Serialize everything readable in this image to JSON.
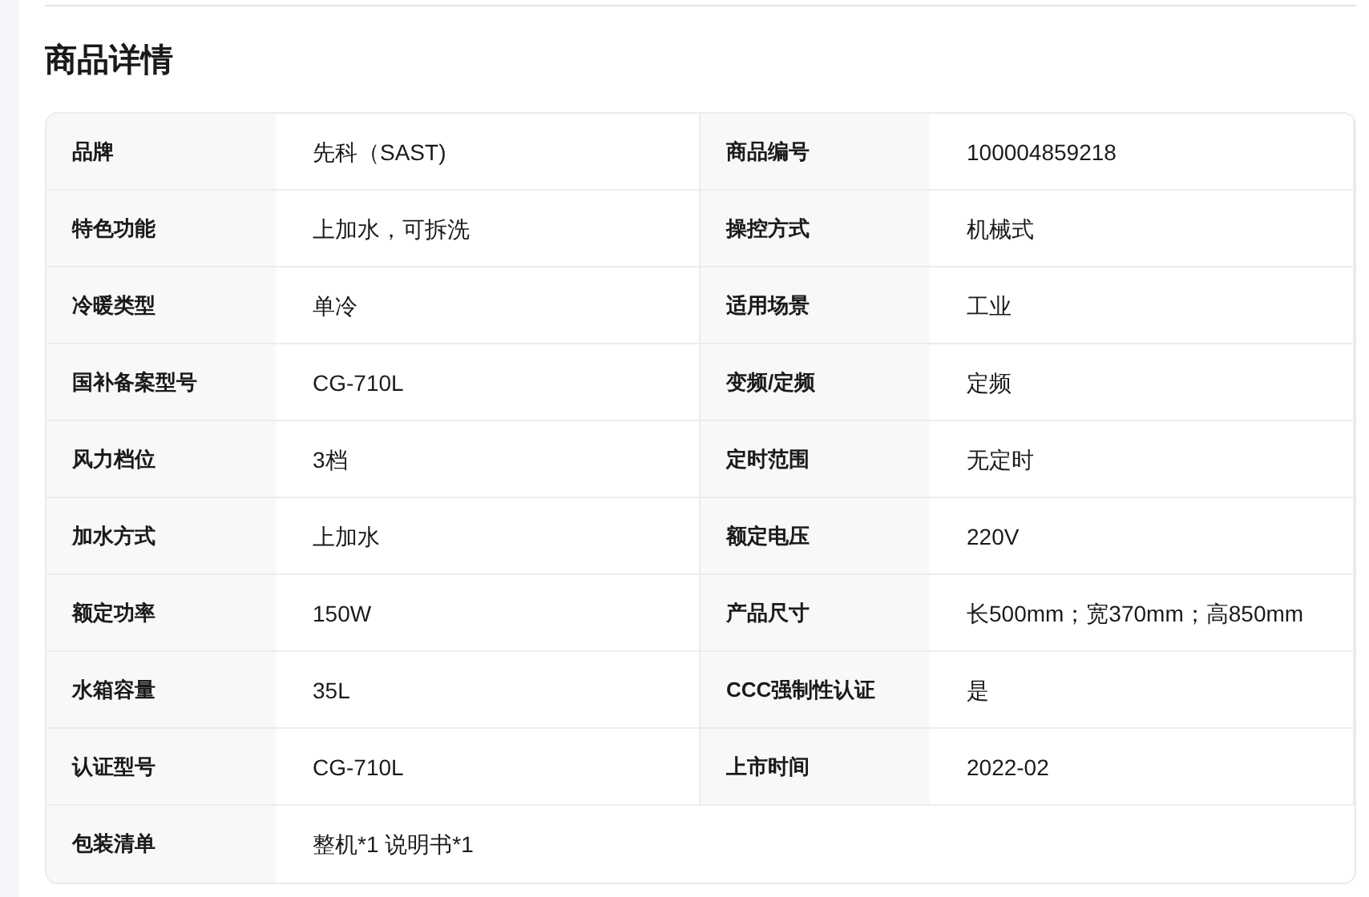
{
  "section_title": "商品详情",
  "specs": [
    {
      "label": "品牌",
      "value": "先科（SAST)"
    },
    {
      "label": "商品编号",
      "value": "100004859218"
    },
    {
      "label": "特色功能",
      "value": "上加水，可拆洗"
    },
    {
      "label": "操控方式",
      "value": "机械式"
    },
    {
      "label": "冷暖类型",
      "value": "单冷"
    },
    {
      "label": "适用场景",
      "value": "工业"
    },
    {
      "label": "国补备案型号",
      "value": "CG-710L"
    },
    {
      "label": "变频/定频",
      "value": "定频"
    },
    {
      "label": "风力档位",
      "value": "3档"
    },
    {
      "label": "定时范围",
      "value": "无定时"
    },
    {
      "label": "加水方式",
      "value": "上加水"
    },
    {
      "label": "额定电压",
      "value": "220V"
    },
    {
      "label": "额定功率",
      "value": "150W"
    },
    {
      "label": "产品尺寸",
      "value": "长500mm；宽370mm；高850mm"
    },
    {
      "label": "水箱容量",
      "value": "35L"
    },
    {
      "label": "CCC强制性认证",
      "value": "是"
    },
    {
      "label": "认证型号",
      "value": "CG-710L"
    },
    {
      "label": "上市时间",
      "value": "2022-02"
    },
    {
      "label": "包装清单",
      "value": "整机*1 说明书*1"
    }
  ]
}
